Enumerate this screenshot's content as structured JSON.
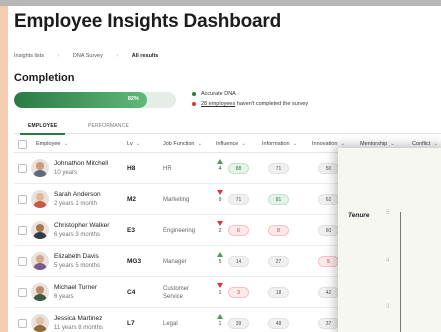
{
  "title": "Employee Insights Dashboard",
  "breadcrumb": {
    "items": [
      "Insights lists",
      "DNA Survey",
      "All results"
    ]
  },
  "completion": {
    "title": "Completion",
    "percent": 82,
    "percent_label": "82%",
    "legend": [
      {
        "text": "Accurate DNA",
        "color": "#2b7a45"
      },
      {
        "count": "28 employees",
        "rest": " haven't completed the survey",
        "color": "#d9363e"
      }
    ]
  },
  "tabs": [
    {
      "label": "EMPLOYEE",
      "active": true
    },
    {
      "label": "PERFORMANCE",
      "active": false
    }
  ],
  "table": {
    "columns": {
      "employee": "Employee",
      "lv": "Lv",
      "job_function": "Job Function",
      "influence": "Influence",
      "information": "Information",
      "innovation": "Innovation",
      "mentorship": "Mentorship",
      "conflict": "Conflict"
    },
    "rows": [
      {
        "name": "Johnathon Mitchell",
        "tenure": "10 years",
        "lv": "H8",
        "fn": "HR",
        "trend": "up",
        "trend_n": "4",
        "influence": "88",
        "inf_style": "green",
        "information": "71",
        "info_style": "grey",
        "innovation": "50",
        "innov_style": "grey"
      },
      {
        "name": "Sarah Anderson",
        "tenure": "2 years 1 month",
        "lv": "M2",
        "fn": "Marketing",
        "trend": "down",
        "trend_n": "9",
        "influence": "71",
        "inf_style": "grey",
        "information": "81",
        "info_style": "green",
        "innovation": "62",
        "innov_style": "grey"
      },
      {
        "name": "Christopher Walker",
        "tenure": "6 years 3 months",
        "lv": "E3",
        "fn": "Engineering",
        "trend": "down",
        "trend_n": "2",
        "influence": "6",
        "inf_style": "red",
        "information": "8",
        "info_style": "red",
        "innovation": "60",
        "innov_style": "grey"
      },
      {
        "name": "Elizabeth Davis",
        "tenure": "5 years 5 months",
        "lv": "MG3",
        "fn": "Manager",
        "trend": "up",
        "trend_n": "5",
        "influence": "14",
        "inf_style": "grey",
        "information": "27",
        "info_style": "grey",
        "innovation": "5",
        "innov_style": "red"
      },
      {
        "name": "Michael Turner",
        "tenure": "6 years",
        "lv": "C4",
        "fn": "Customer Service",
        "trend": "down",
        "trend_n": "1",
        "influence": "3",
        "inf_style": "red",
        "information": "18",
        "info_style": "grey",
        "innovation": "42",
        "innov_style": "grey"
      },
      {
        "name": "Jessica Martinez",
        "tenure": "11 years 8 months",
        "lv": "L7",
        "fn": "Legal",
        "trend": "up",
        "trend_n": "1",
        "influence": "39",
        "inf_style": "grey",
        "information": "48",
        "info_style": "grey",
        "innovation": "37",
        "innov_style": "grey"
      }
    ]
  },
  "overlay": {
    "label": "Tenure",
    "ticks": [
      "5",
      "4",
      "3"
    ]
  }
}
